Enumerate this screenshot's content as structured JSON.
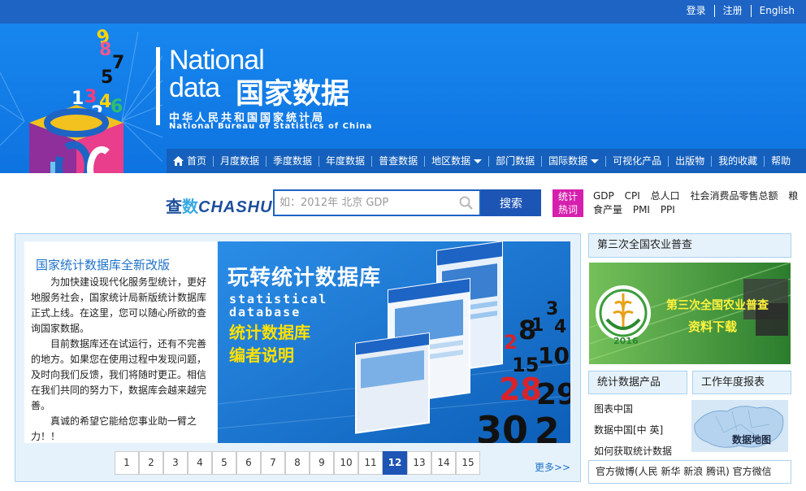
{
  "topbar": {
    "login": "登录",
    "register": "注册",
    "english": "English"
  },
  "logo": {
    "en_line1": "National",
    "en_line2": "data",
    "cn": "国家数据",
    "sub_cn": "中华人民共和国国家统计局",
    "sub_en": "National Bureau of Statistics of China"
  },
  "nav": {
    "items": [
      {
        "label": "首页"
      },
      {
        "label": "月度数据"
      },
      {
        "label": "季度数据"
      },
      {
        "label": "年度数据"
      },
      {
        "label": "普查数据"
      },
      {
        "label": "地区数据"
      },
      {
        "label": "部门数据"
      },
      {
        "label": "国际数据"
      },
      {
        "label": "可视化产品"
      },
      {
        "label": "出版物"
      },
      {
        "label": "我的收藏"
      },
      {
        "label": "帮助"
      }
    ]
  },
  "search": {
    "logo_cha": "查",
    "logo_shu": "数",
    "logo_en": "CHASHU",
    "placeholder": "如：2012年 北京 GDP",
    "button": "搜索",
    "hot_label_1": "统计",
    "hot_label_2": "热词",
    "hot_words": [
      "GDP",
      "CPI",
      "总人口",
      "社会消费品零售总额",
      "粮食产量",
      "PMI",
      "PPI"
    ]
  },
  "notice": {
    "title": "国家统计数据库全新改版",
    "para1": "为加快建设现代化服务型统计，更好地服务社会，国家统计局新版统计数据库正式上线。在这里，您可以随心所欲的查询国家数据。",
    "para2": "目前数据库还在试运行，还有不完善的地方。如果您在使用过程中发现问题，及时向我们反馈，我们将随时更正。相信在我们共同的努力下，数据库会越来越完善。",
    "para3": "真诚的希望它能给您事业助一臂之力！！"
  },
  "banner": {
    "title": "玩转统计数据库",
    "en1": "statistical",
    "en2": "database",
    "cn1": "统计数据库",
    "cn2": "编者说明"
  },
  "pager": {
    "pages": [
      "1",
      "2",
      "3",
      "4",
      "5",
      "6",
      "7",
      "8",
      "9",
      "10",
      "11",
      "12",
      "13",
      "14",
      "15"
    ],
    "active": "12",
    "more": "更多>>"
  },
  "side": {
    "census_title": "第三次全国农业普查",
    "census_img_line1": "第三次全国农业普查",
    "census_img_line2": "资料下载",
    "census_year": "2016",
    "products_tab": "统计数据产品",
    "report_tab": "工作年度报表",
    "links": [
      "图表中国",
      "数据中国[中 英]",
      "如何获取统计数据"
    ],
    "map_label": "数据地图",
    "weibo": "官方微博(人民 新华 新浪 腾讯) 官方微信"
  },
  "colors": {
    "brand_blue": "#1d64c5",
    "nav_blue": "#1560bd",
    "hot_pink": "#d61fae",
    "link_blue": "#1f72c9",
    "banner_yellow": "#ffe100"
  }
}
